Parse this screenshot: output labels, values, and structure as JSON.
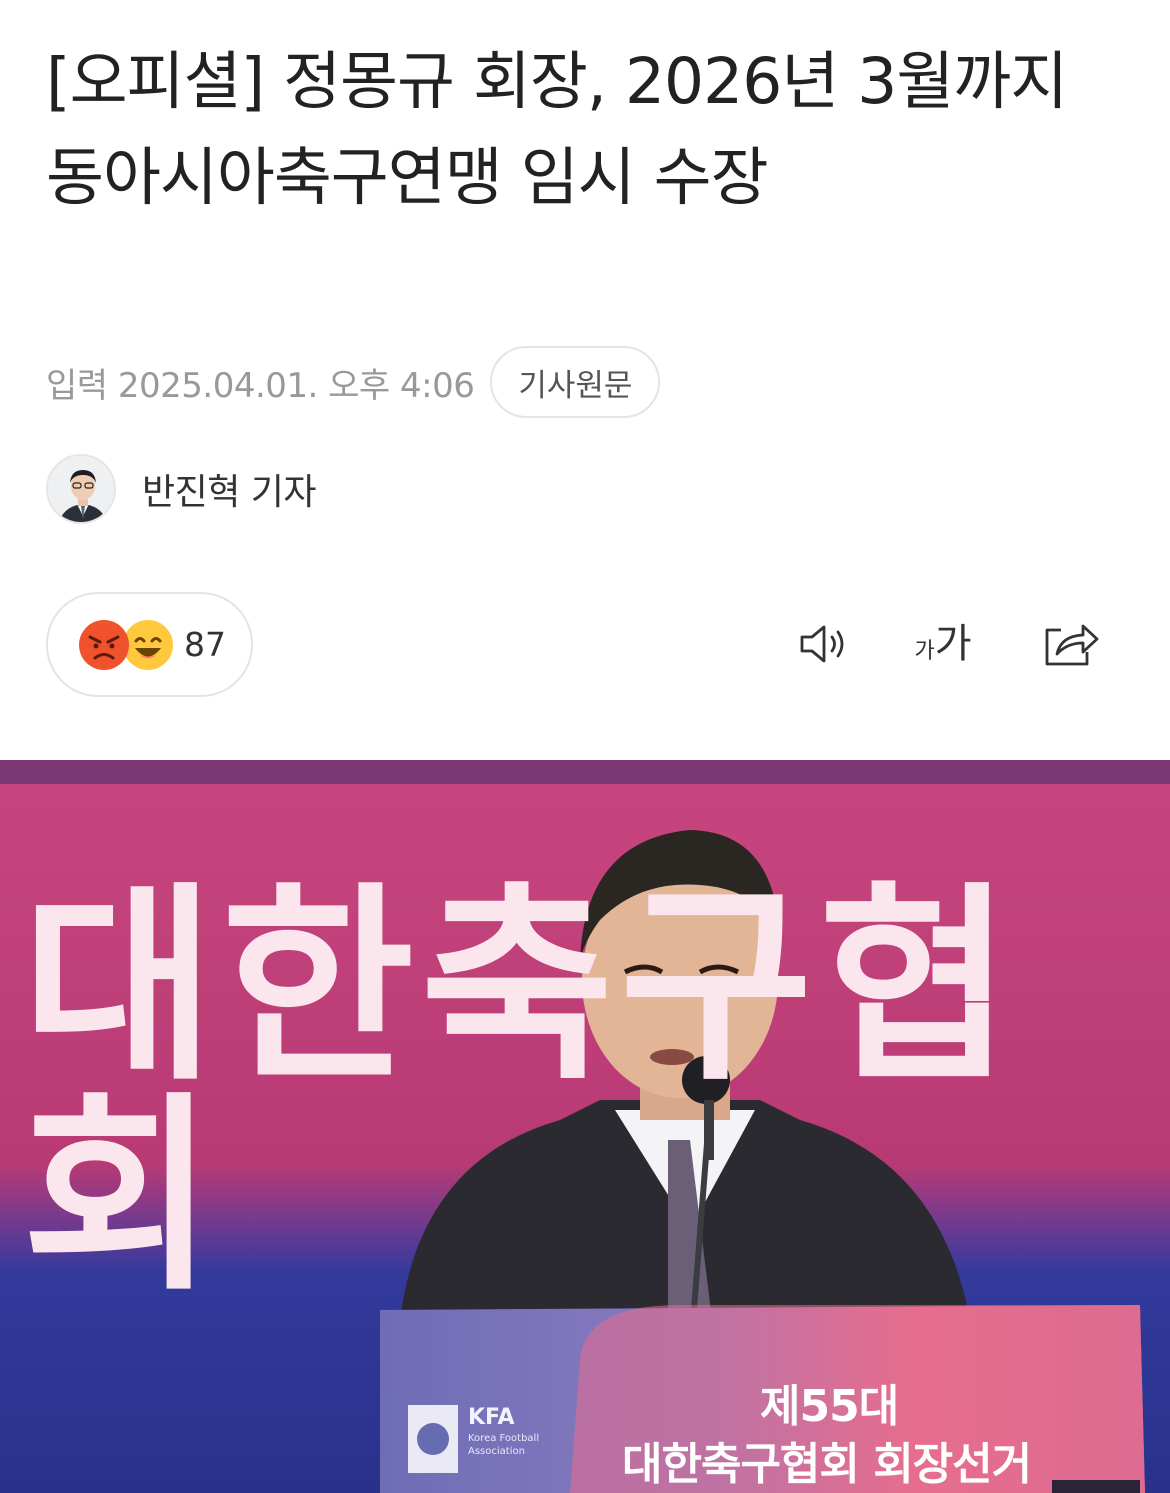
{
  "article": {
    "title": "[오피셜] 정몽규 회장, 2026년 3월까지 동아시아축구연맹 임시 수장",
    "date": "입력 2025.04.01. 오후 4:06",
    "origin_button": "기사원문",
    "author": "반진혁 기자"
  },
  "reactions": {
    "count": "87",
    "emojis": [
      "angry-emoji",
      "laughing-emoji"
    ]
  },
  "toolbar": {
    "speaker_icon": "speaker-icon",
    "font_size_small": "가",
    "font_size_big": "가",
    "share_icon": "share-icon"
  },
  "photo": {
    "banner_text": "대한축구협회",
    "podium_line1": "제55대",
    "podium_line2": "대한축구협회 회장선거",
    "kfa_logo": "KFA",
    "kfa_sub": "Korea Football Association",
    "colors": {
      "banner_pink": "#c43a77",
      "banner_blue": "#2e3596",
      "podium": "#7b75b9",
      "podium_pink": "#e9688f"
    }
  }
}
